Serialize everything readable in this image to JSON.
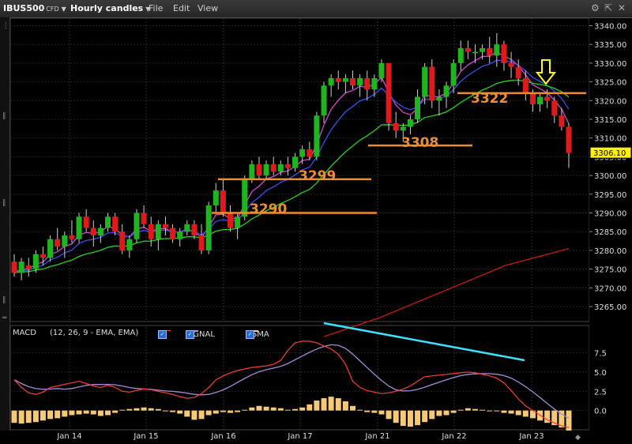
{
  "toolbar": {
    "symbol": "IBUS500",
    "symbol_suffix": "CFD",
    "timeframe": "Hourly candles",
    "menus": [
      "File",
      "Edit",
      "View"
    ]
  },
  "price_axis": {
    "ticks": [
      "3340.00",
      "3335.00",
      "3330.00",
      "3325.00",
      "3320.00",
      "3315.00",
      "3310.00",
      "3305.00",
      "3300.00",
      "3295.00",
      "3290.00",
      "3285.00",
      "3280.00",
      "3275.00",
      "3270.00",
      "3265.00"
    ],
    "current_price": "3306.10"
  },
  "macd_panel": {
    "title": "MACD",
    "params": "(12, 26, 9 - EMA, EMA)",
    "signal_label": "SIGNAL",
    "osma_label": "OSMA",
    "ticks": [
      "7.5",
      "5.0",
      "2.5",
      "0.0"
    ]
  },
  "annotations": {
    "levels": [
      "3322",
      "3308",
      "3299",
      "3290"
    ]
  },
  "time_axis": {
    "labels": [
      "Jan 14",
      "Jan 15",
      "Jan 16",
      "Jan 17",
      "Jan 21",
      "Jan 22",
      "Jan 23"
    ]
  },
  "colors": {
    "bull": "#1fb51f",
    "bear": "#e01a1a",
    "ema_fast": "#d24bd2",
    "ema_mid": "#3b4ff0",
    "ema_slow": "#27d127",
    "ema_long": "#c81818",
    "level": "#f08c2a",
    "arrow": "#ffff00",
    "divergence": "#3fe0ff",
    "macd_line": "#ff3b3b",
    "signal_line": "#a58bd8",
    "osma": "#f6c975"
  },
  "chart_data": {
    "type": "candlestick",
    "price_range": [
      3261,
      3342
    ],
    "candles": [
      [
        3277,
        3279,
        3273,
        3274
      ],
      [
        3274,
        3278,
        3272,
        3277
      ],
      [
        3276,
        3278,
        3273,
        3275
      ],
      [
        3275,
        3280,
        3274,
        3279
      ],
      [
        3279,
        3281,
        3276,
        3278
      ],
      [
        3278,
        3284,
        3277,
        3283
      ],
      [
        3283,
        3286,
        3280,
        3281
      ],
      [
        3281,
        3285,
        3278,
        3284
      ],
      [
        3284,
        3288,
        3282,
        3283
      ],
      [
        3283,
        3290,
        3282,
        3289
      ],
      [
        3289,
        3291,
        3285,
        3286
      ],
      [
        3286,
        3288,
        3281,
        3284
      ],
      [
        3284,
        3287,
        3282,
        3286
      ],
      [
        3286,
        3290,
        3285,
        3289
      ],
      [
        3289,
        3290,
        3284,
        3285
      ],
      [
        3285,
        3287,
        3279,
        3280
      ],
      [
        3280,
        3284,
        3278,
        3283
      ],
      [
        3283,
        3291,
        3282,
        3290
      ],
      [
        3290,
        3292,
        3286,
        3287
      ],
      [
        3287,
        3289,
        3281,
        3283
      ],
      [
        3283,
        3288,
        3280,
        3287
      ],
      [
        3287,
        3289,
        3284,
        3286
      ],
      [
        3286,
        3287,
        3282,
        3283
      ],
      [
        3283,
        3286,
        3281,
        3285
      ],
      [
        3285,
        3288,
        3284,
        3287
      ],
      [
        3287,
        3288,
        3283,
        3284
      ],
      [
        3284,
        3287,
        3279,
        3280
      ],
      [
        3280,
        3293,
        3279,
        3292
      ],
      [
        3292,
        3298,
        3290,
        3296
      ],
      [
        3296,
        3299,
        3289,
        3290
      ],
      [
        3290,
        3292,
        3285,
        3286
      ],
      [
        3286,
        3290,
        3283,
        3289
      ],
      [
        3289,
        3300,
        3288,
        3299
      ],
      [
        3299,
        3304,
        3298,
        3303
      ],
      [
        3303,
        3305,
        3299,
        3300
      ],
      [
        3300,
        3304,
        3299,
        3303
      ],
      [
        3303,
        3305,
        3300,
        3301
      ],
      [
        3301,
        3304,
        3300,
        3303
      ],
      [
        3303,
        3305,
        3300,
        3302
      ],
      [
        3302,
        3306,
        3301,
        3305
      ],
      [
        3305,
        3308,
        3303,
        3307
      ],
      [
        3307,
        3309,
        3304,
        3305
      ],
      [
        3305,
        3317,
        3304,
        3316
      ],
      [
        3316,
        3325,
        3314,
        3324
      ],
      [
        3324,
        3327,
        3321,
        3326
      ],
      [
        3326,
        3328,
        3323,
        3325
      ],
      [
        3325,
        3327,
        3322,
        3326
      ],
      [
        3326,
        3328,
        3323,
        3324
      ],
      [
        3324,
        3327,
        3321,
        3326
      ],
      [
        3326,
        3328,
        3320,
        3323
      ],
      [
        3323,
        3327,
        3321,
        3326
      ],
      [
        3326,
        3331,
        3325,
        3330
      ],
      [
        3330,
        3322,
        3312,
        3314
      ],
      [
        3314,
        3317,
        3310,
        3312
      ],
      [
        3312,
        3314,
        3309,
        3313
      ],
      [
        3313,
        3316,
        3311,
        3315
      ],
      [
        3315,
        3323,
        3314,
        3321
      ],
      [
        3321,
        3330,
        3319,
        3329
      ],
      [
        3329,
        3331,
        3318,
        3320
      ],
      [
        3320,
        3323,
        3316,
        3321
      ],
      [
        3321,
        3325,
        3318,
        3324
      ],
      [
        3324,
        3331,
        3322,
        3330
      ],
      [
        3330,
        3336,
        3328,
        3334
      ],
      [
        3334,
        3336,
        3331,
        3333
      ],
      [
        3333,
        3335,
        3330,
        3333
      ],
      [
        3333,
        3335,
        3331,
        3334
      ],
      [
        3334,
        3337,
        3330,
        3332
      ],
      [
        3332,
        3338,
        3329,
        3335
      ],
      [
        3335,
        3336,
        3328,
        3330
      ],
      [
        3330,
        3333,
        3326,
        3329
      ],
      [
        3329,
        3331,
        3324,
        3326
      ],
      [
        3326,
        3328,
        3320,
        3322
      ],
      [
        3322,
        3323,
        3317,
        3319
      ],
      [
        3319,
        3322,
        3317,
        3321
      ],
      [
        3321,
        3323,
        3318,
        3320
      ],
      [
        3320,
        3321,
        3314,
        3316
      ],
      [
        3316,
        3318,
        3312,
        3313
      ],
      [
        3313,
        3314,
        3302,
        3306
      ]
    ],
    "levels": [
      3322,
      3308,
      3299,
      3290
    ],
    "macd_range": [
      -2.5,
      9.2
    ]
  }
}
